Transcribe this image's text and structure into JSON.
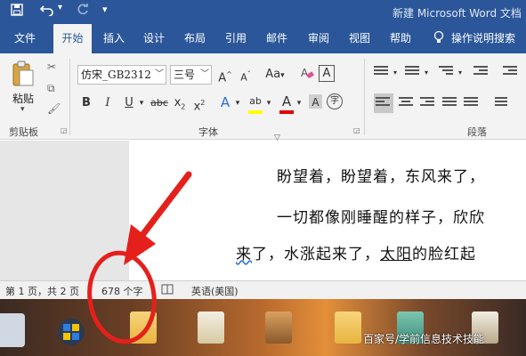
{
  "window": {
    "title": "新建 Microsoft Word 文档"
  },
  "quick_access": {
    "save_icon": "save-icon",
    "undo_icon": "undo-icon",
    "redo_icon": "redo-icon",
    "customize_icon": "chevron-down-icon"
  },
  "tabs": [
    {
      "label": "文件"
    },
    {
      "label": "开始",
      "active": true
    },
    {
      "label": "插入"
    },
    {
      "label": "设计"
    },
    {
      "label": "布局"
    },
    {
      "label": "引用"
    },
    {
      "label": "邮件"
    },
    {
      "label": "审阅"
    },
    {
      "label": "视图"
    },
    {
      "label": "帮助"
    }
  ],
  "tell_me": {
    "label": "操作说明搜索",
    "icon": "lightbulb-icon"
  },
  "ribbon": {
    "clipboard": {
      "paste_label": "粘贴",
      "group_label": "剪贴板"
    },
    "font": {
      "font_name": "仿宋_GB2312",
      "font_size": "三号",
      "grow": "A",
      "shrink": "A",
      "change_case": "Aa",
      "clear_format_icon": "clear-formatting-icon",
      "char_border": "A",
      "bold": "B",
      "italic": "I",
      "underline": "U",
      "strikethrough": "abc",
      "subscript": "x",
      "superscript": "x",
      "text_effects": "A",
      "highlight": "ab",
      "font_color": "A",
      "char_shading": "A",
      "enclose_char": "字",
      "group_label": "字体"
    },
    "paragraph": {
      "group_label": "段落"
    }
  },
  "document": {
    "lines": [
      "盼望着，盼望着，东风来了，",
      "一切都像刚睡醒的样子，欣欣",
      {
        "pre": "来",
        "mid": "了，水涨起来了，",
        "u": "太阳",
        "post": "的脸红起"
      }
    ]
  },
  "status": {
    "page": "第 1 页，共 2 页",
    "words": "678 个字",
    "language": "英语(美国)"
  },
  "taskbar": {
    "watermark": "百家号/学前信息技术技能"
  },
  "colors": {
    "title_bar": "#2b579a",
    "annotation": "#e5201c",
    "highlight": "#ffff00",
    "font_color": "#e00000"
  }
}
